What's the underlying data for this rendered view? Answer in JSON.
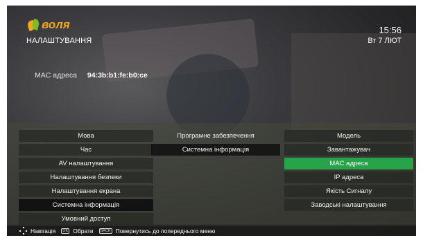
{
  "header": {
    "logo_text": "воля",
    "title": "НАЛАШТУВАННЯ",
    "time": "15:56",
    "date": "Вт 7 ЛЮТ"
  },
  "info": {
    "mac_label": "MAC адреса",
    "mac_value": "94:3b:b1:fe:b0:ce"
  },
  "menu_left": [
    {
      "label": "Мова"
    },
    {
      "label": "Час"
    },
    {
      "label": "AV налаштування"
    },
    {
      "label": "Налаштування безпеки"
    },
    {
      "label": "Налаштування екрана"
    },
    {
      "label": "Системна інформація",
      "selected": true
    },
    {
      "label": "Умовний доступ"
    }
  ],
  "menu_middle": [
    {
      "label": "Програмне забезпечення"
    },
    {
      "label": "Системна інформація",
      "selected": true
    }
  ],
  "menu_right": [
    {
      "label": "Модель"
    },
    {
      "label": "Завантажувач"
    },
    {
      "label": "MAC адреса",
      "active": true
    },
    {
      "label": "IP адреса"
    },
    {
      "label": "Якість Сигналу"
    },
    {
      "label": "Заводські налаштування"
    }
  ],
  "footer": {
    "nav_label": "Навігація",
    "ok_key": "OK",
    "select_label": "Обрати",
    "back_key": "BACK",
    "back_label": "Повернутись до попереднього меню"
  },
  "colors": {
    "accent_green": "#27a44a",
    "logo_orange": "#f5a623"
  }
}
